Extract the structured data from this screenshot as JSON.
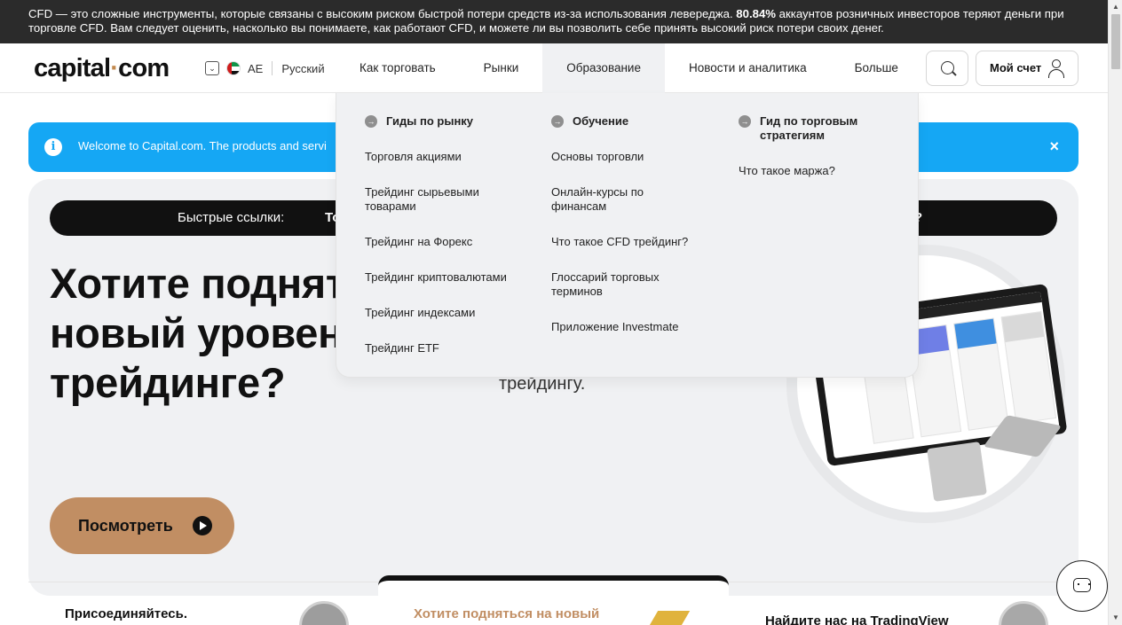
{
  "risk_banner": {
    "text_before": "CFD — это сложные инструменты, которые связаны с высоким риском быстрой потери средств из-за использования левереджа. ",
    "percent": "80.84%",
    "text_after": " аккаунтов розничных инвесторов теряют деньги при торговле CFD. Вам следует оценить, насколько вы понимаете, как работают CFD, и можете ли вы позволить себе принять высокий риск потери своих денег."
  },
  "header": {
    "logo_main": "capital",
    "logo_dot": "·",
    "logo_tld": "com",
    "region_code": "AE",
    "language": "Русский",
    "nav": [
      "Как торговать",
      "Рынки",
      "Образование",
      "Новости и аналитика",
      "Больше"
    ],
    "active_nav": "Образование",
    "account_label": "Мой счет"
  },
  "info_banner": {
    "icon": "i",
    "text": "Welcome to Capital.com. The products and servi",
    "close": "×"
  },
  "hero": {
    "quick_links_label": "Быстрые ссылки:",
    "quick_link_1": "То",
    "quick_link_2": "?",
    "title": [
      "Хотите поднят",
      "новый уровен",
      "трейдинге?"
    ],
    "subtitle": "трейдингу.",
    "watch_label": "Посмотреть"
  },
  "dropdown": {
    "columns": [
      {
        "heading": "Гиды по рынку",
        "items": [
          "Торговля акциями",
          "Трейдинг сырьевыми товарами",
          "Трейдинг на Форекс",
          "Трейдинг криптовалютами",
          "Трейдинг индексами",
          "Трейдинг ETF"
        ]
      },
      {
        "heading": "Обучение",
        "items": [
          "Основы торговли",
          "Онлайн-курсы по финансам",
          "Что такое CFD трейдинг?",
          "Глоссарий торговых терминов",
          "Приложение Investmate"
        ]
      },
      {
        "heading": "Гид по торговым стратегиям",
        "items": [
          "Что такое маржа?"
        ]
      }
    ]
  },
  "bottom": {
    "join_text": "Присоединяйтесь.",
    "promo_text": "Хотите подняться на новый",
    "tradingview_text": "Найдите нас на TradingView"
  },
  "colors": {
    "brand_accent": "#c18e63",
    "info_blue": "#15a7f4",
    "dark": "#111111"
  }
}
